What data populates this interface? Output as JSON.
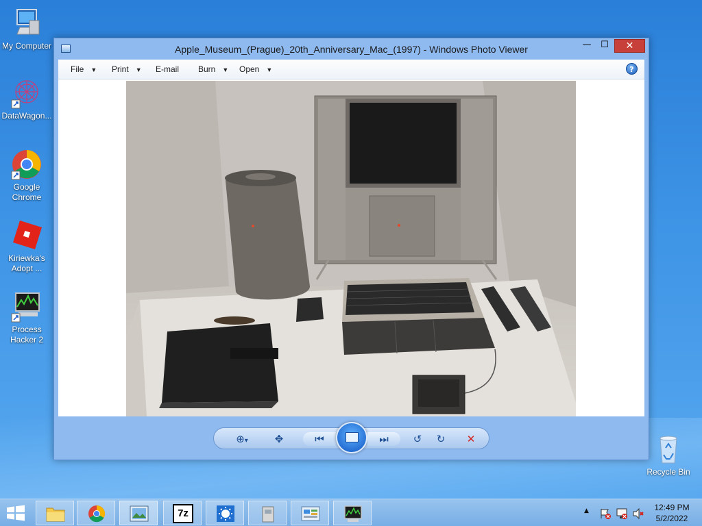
{
  "desktop": {
    "icons": [
      {
        "label": "My Computer"
      },
      {
        "label": "DataWagon..."
      },
      {
        "label": "Google Chrome"
      },
      {
        "label": "Kiriewka's Adopt ..."
      },
      {
        "label": "Process Hacker 2"
      },
      {
        "label": "Recycle Bin"
      }
    ]
  },
  "window": {
    "title": "Apple_Museum_(Prague)_20th_Anniversary_Mac_(1997) - Windows Photo Viewer",
    "min_symbol": "—",
    "max_symbol": "☐",
    "close_symbol": "✕",
    "menu": [
      "File",
      "Print",
      "E-mail",
      "Burn",
      "Open"
    ],
    "menu_arrow": "▼",
    "help_symbol": "?"
  },
  "controls": {
    "zoom": "⊕",
    "zoom_arrow": "▾",
    "fit": "✥",
    "prev": "⏮",
    "next": "⏭",
    "rotate_ccw": "↺",
    "rotate_cw": "↻",
    "delete": "✕"
  },
  "taskbar": {
    "time": "12:49 PM",
    "date": "5/2/2022",
    "tray_arrow": "▲",
    "seven_zip": "7z"
  },
  "colors": {
    "accent": "#2a7fd8",
    "close": "#c7413a",
    "delete": "#d3221b"
  }
}
